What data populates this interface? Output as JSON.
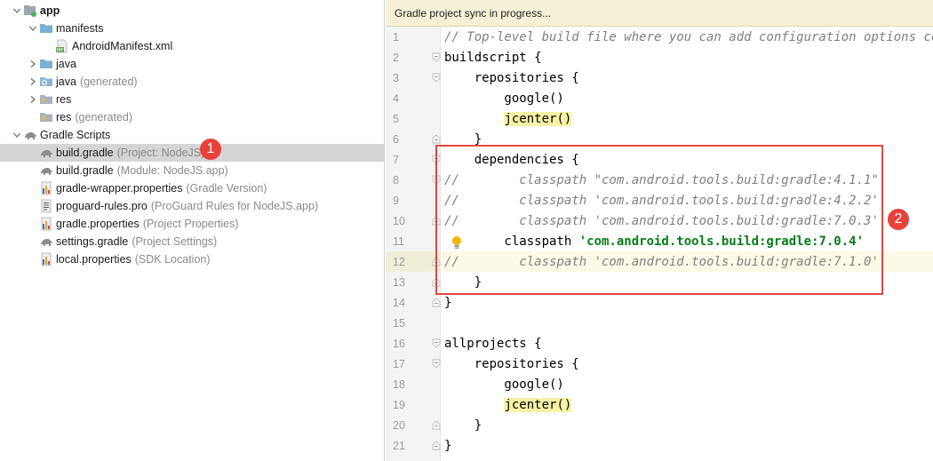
{
  "tree": {
    "items": [
      {
        "label": "app",
        "hint": "",
        "indent": 0,
        "expanded": true,
        "icon": "module-icon",
        "bold": true
      },
      {
        "label": "manifests",
        "hint": "",
        "indent": 1,
        "expanded": true,
        "icon": "folder-icon"
      },
      {
        "label": "AndroidManifest.xml",
        "hint": "",
        "indent": 2,
        "expanded": null,
        "icon": "manifest-file-icon"
      },
      {
        "label": "java",
        "hint": "",
        "indent": 1,
        "expanded": false,
        "icon": "source-folder-icon"
      },
      {
        "label": "java",
        "hint": "(generated)",
        "indent": 1,
        "expanded": false,
        "icon": "generated-folder-icon"
      },
      {
        "label": "res",
        "hint": "",
        "indent": 1,
        "expanded": false,
        "icon": "resource-folder-icon"
      },
      {
        "label": "res",
        "hint": "(generated)",
        "indent": 1,
        "expanded": null,
        "icon": "resource-folder-icon"
      },
      {
        "label": "Gradle Scripts",
        "hint": "",
        "indent": 0,
        "expanded": true,
        "icon": "gradle-icon"
      },
      {
        "label": "build.gradle",
        "hint": "(Project: NodeJS)",
        "indent": 1,
        "expanded": null,
        "icon": "gradle-icon",
        "selected": true
      },
      {
        "label": "build.gradle",
        "hint": "(Module: NodeJS.app)",
        "indent": 1,
        "expanded": null,
        "icon": "gradle-icon"
      },
      {
        "label": "gradle-wrapper.properties",
        "hint": "(Gradle Version)",
        "indent": 1,
        "expanded": null,
        "icon": "properties-file-icon"
      },
      {
        "label": "proguard-rules.pro",
        "hint": "(ProGuard Rules for NodeJS.app)",
        "indent": 1,
        "expanded": null,
        "icon": "text-file-icon"
      },
      {
        "label": "gradle.properties",
        "hint": "(Project Properties)",
        "indent": 1,
        "expanded": null,
        "icon": "properties-file-icon"
      },
      {
        "label": "settings.gradle",
        "hint": "(Project Settings)",
        "indent": 1,
        "expanded": null,
        "icon": "gradle-icon"
      },
      {
        "label": "local.properties",
        "hint": "(SDK Location)",
        "indent": 1,
        "expanded": null,
        "icon": "properties-file-icon"
      }
    ]
  },
  "annotations": {
    "badge1": "1",
    "badge2": "2"
  },
  "editor": {
    "banner": "Gradle project sync in progress...",
    "current_line": 12,
    "lines": [
      {
        "n": "1",
        "tokens": [
          {
            "t": "// Top-level build file where you can add configuration options common",
            "k": "comment"
          }
        ]
      },
      {
        "n": "2",
        "fold": "open",
        "tokens": [
          {
            "t": "buildscript {",
            "k": "plain"
          }
        ]
      },
      {
        "n": "3",
        "fold": "open",
        "tokens": [
          {
            "t": "    repositories {",
            "k": "plain"
          }
        ]
      },
      {
        "n": "4",
        "tokens": [
          {
            "t": "        google()",
            "k": "plain"
          }
        ]
      },
      {
        "n": "5",
        "tokens": [
          {
            "t": "        ",
            "k": "plain"
          },
          {
            "t": "jcenter()",
            "k": "hl"
          }
        ]
      },
      {
        "n": "6",
        "fold": "close",
        "tokens": [
          {
            "t": "    }",
            "k": "plain"
          }
        ]
      },
      {
        "n": "7",
        "fold": "open",
        "tokens": [
          {
            "t": "    dependencies {",
            "k": "plain"
          }
        ]
      },
      {
        "n": "8",
        "fold": "open",
        "tokens": [
          {
            "t": "//",
            "k": "comment"
          },
          {
            "t": "        classpath \"com.android.tools.build:gradle:4.1.1\"",
            "k": "comment"
          }
        ]
      },
      {
        "n": "9",
        "tokens": [
          {
            "t": "//",
            "k": "comment"
          },
          {
            "t": "        classpath 'com.android.tools.build:gradle:4.2.2'",
            "k": "comment"
          }
        ]
      },
      {
        "n": "10",
        "fold": "close",
        "tokens": [
          {
            "t": "//",
            "k": "comment"
          },
          {
            "t": "        classpath 'com.android.tools.build:gradle:7.0.3'",
            "k": "comment"
          }
        ]
      },
      {
        "n": "11",
        "tokens": [
          {
            "t": "        classpath ",
            "k": "plain"
          },
          {
            "t": "'com.android.tools.build:gradle:7.0.4'",
            "k": "str"
          }
        ]
      },
      {
        "n": "12",
        "fold": "close",
        "tokens": [
          {
            "t": "//",
            "k": "comment"
          },
          {
            "t": "        classpath 'com.android.tools.build:gradle:7.1.0'",
            "k": "comment"
          }
        ]
      },
      {
        "n": "13",
        "fold": "close",
        "tokens": [
          {
            "t": "    }",
            "k": "plain"
          }
        ]
      },
      {
        "n": "14",
        "fold": "close",
        "tokens": [
          {
            "t": "}",
            "k": "plain"
          }
        ]
      },
      {
        "n": "15",
        "tokens": [
          {
            "t": "",
            "k": "plain"
          }
        ]
      },
      {
        "n": "16",
        "fold": "open",
        "tokens": [
          {
            "t": "allprojects {",
            "k": "plain"
          }
        ]
      },
      {
        "n": "17",
        "fold": "open",
        "tokens": [
          {
            "t": "    repositories {",
            "k": "plain"
          }
        ]
      },
      {
        "n": "18",
        "tokens": [
          {
            "t": "        google()",
            "k": "plain"
          }
        ]
      },
      {
        "n": "19",
        "tokens": [
          {
            "t": "        ",
            "k": "plain"
          },
          {
            "t": "jcenter()",
            "k": "hl"
          }
        ]
      },
      {
        "n": "20",
        "fold": "close",
        "tokens": [
          {
            "t": "    }",
            "k": "plain"
          }
        ]
      },
      {
        "n": "21",
        "fold": "close",
        "tokens": [
          {
            "t": "}",
            "k": "plain"
          }
        ]
      }
    ]
  },
  "colors": {
    "badge": "#e8413a",
    "highlight_box": "#e04a44",
    "string": "#067d17",
    "comment": "#808080",
    "selection": "#d5d5d5"
  }
}
